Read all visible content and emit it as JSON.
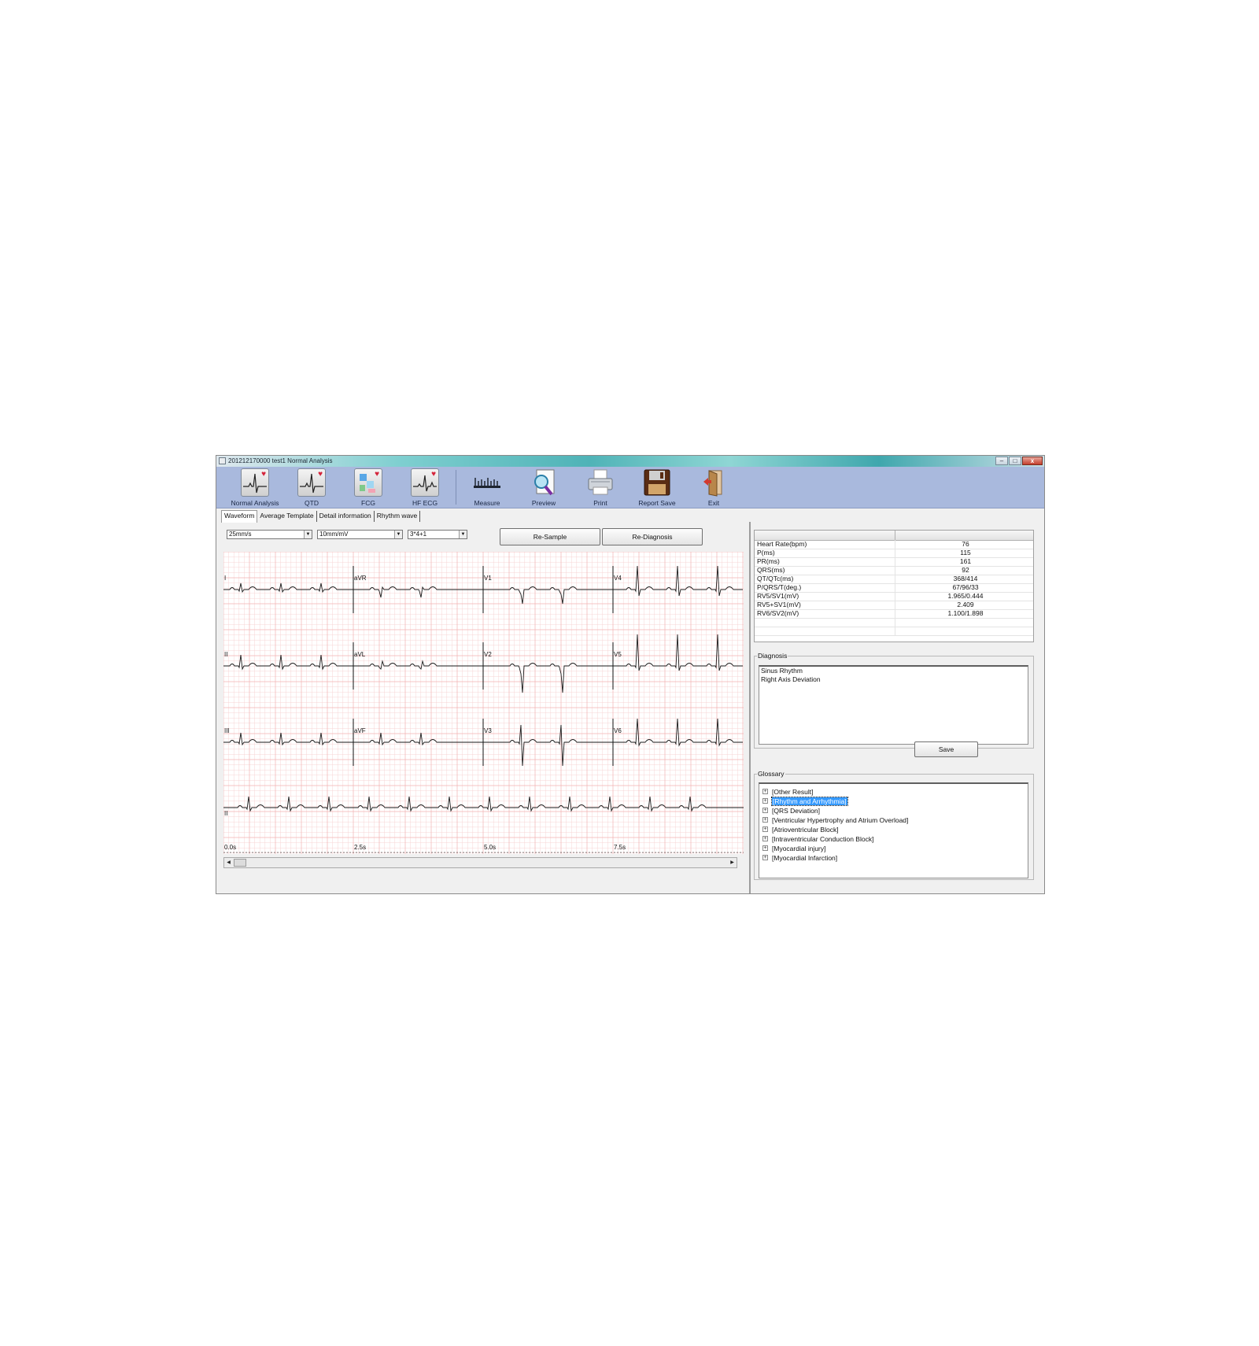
{
  "window": {
    "title": "201212170000  test1  Normal Analysis",
    "buttons": {
      "minimize": "–",
      "maximize": "□",
      "close": "x"
    }
  },
  "toolbar": {
    "items": [
      {
        "label": "Normal Analysis",
        "icon": "ecg-heart-icon"
      },
      {
        "label": "QTD",
        "icon": "ecg-heart-icon"
      },
      {
        "label": "FCG",
        "icon": "fcg-icon"
      },
      {
        "label": "HF ECG",
        "icon": "ecg-heart-icon"
      },
      {
        "label": "Measure",
        "icon": "ruler-icon"
      },
      {
        "label": "Preview",
        "icon": "magnifier-icon"
      },
      {
        "label": "Print",
        "icon": "printer-icon"
      },
      {
        "label": "Report Save",
        "icon": "floppy-disk-icon"
      },
      {
        "label": "Exit",
        "icon": "exit-door-icon"
      }
    ]
  },
  "tabs": [
    "Waveform",
    "Average Template",
    "Detail information",
    "Rhythm wave"
  ],
  "active_tab": "Waveform",
  "controls": {
    "speed": "25mm/s",
    "gain": "10mm/mV",
    "layout": "3*4+1",
    "resample_label": "Re-Sample",
    "rediagnosis_label": "Re-Diagnosis"
  },
  "ecg": {
    "leads": [
      [
        "I",
        "aVR",
        "V1",
        "V4"
      ],
      [
        "II",
        "aVL",
        "V2",
        "V5"
      ],
      [
        "III",
        "aVF",
        "V3",
        "V6"
      ]
    ],
    "rhythm_lead": "II",
    "time_labels": [
      "0.0s",
      "2.5s",
      "5.0s",
      "7.5s"
    ],
    "grid_color": "#f2b3b3",
    "trace_color": "#1a1a1a"
  },
  "measurements": [
    {
      "key": "Heart Rate(bpm)",
      "value": "76"
    },
    {
      "key": "P(ms)",
      "value": "115"
    },
    {
      "key": "PR(ms)",
      "value": "161"
    },
    {
      "key": "QRS(ms)",
      "value": "92"
    },
    {
      "key": "QT/QTc(ms)",
      "value": "368/414"
    },
    {
      "key": "P/QRS/T(deg.)",
      "value": "67/96/33"
    },
    {
      "key": "RV5/SV1(mV)",
      "value": "1.965/0.444"
    },
    {
      "key": "RV5+SV1(mV)",
      "value": "2.409"
    },
    {
      "key": "RV6/SV2(mV)",
      "value": "1.100/1.898"
    }
  ],
  "diagnosis": {
    "label": "Diagnosis",
    "lines": [
      "Sinus Rhythm",
      "Right Axis Deviation"
    ],
    "save_label": "Save"
  },
  "glossary": {
    "label": "Glossary",
    "items": [
      "[Other Result]",
      "[Rhythm and Arrhythmia]",
      "[QRS Deviation]",
      "[Ventricular Hypertrophy and Atrium  Overload]",
      "[Atrioventricular Block]",
      "[Intraventricular Conduction Block]",
      "[Myocardial injury]",
      "[Myocardial Infarction]"
    ],
    "selected": "[Rhythm and Arrhythmia]"
  }
}
